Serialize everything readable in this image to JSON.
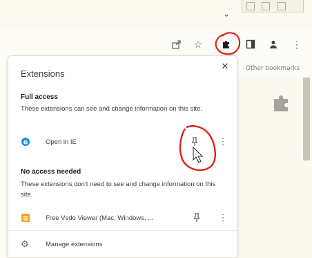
{
  "browser": {
    "bookmarks_bar": {
      "other_bookmarks_label": "Other bookmarks"
    }
  },
  "extensions_popup": {
    "title": "Extensions",
    "full_access": {
      "heading": "Full access",
      "description": "These extensions can see and change information on this site.",
      "items": [
        {
          "name": "Open in IE",
          "icon": "open-in-ie-icon",
          "color": "#1e88e5"
        }
      ]
    },
    "no_access": {
      "heading": "No access needed",
      "description": "These extensions don't need to see and change information on this site.",
      "items": [
        {
          "name": "Free Vsdo Viewer (Mac, Windows, ...",
          "icon": "vsdo-viewer-icon",
          "color": "#f4a31a"
        }
      ]
    },
    "manage_label": "Manage extensions"
  },
  "colors": {
    "annotation_red": "#d9241b",
    "extensions_button_highlight": "#202124"
  }
}
